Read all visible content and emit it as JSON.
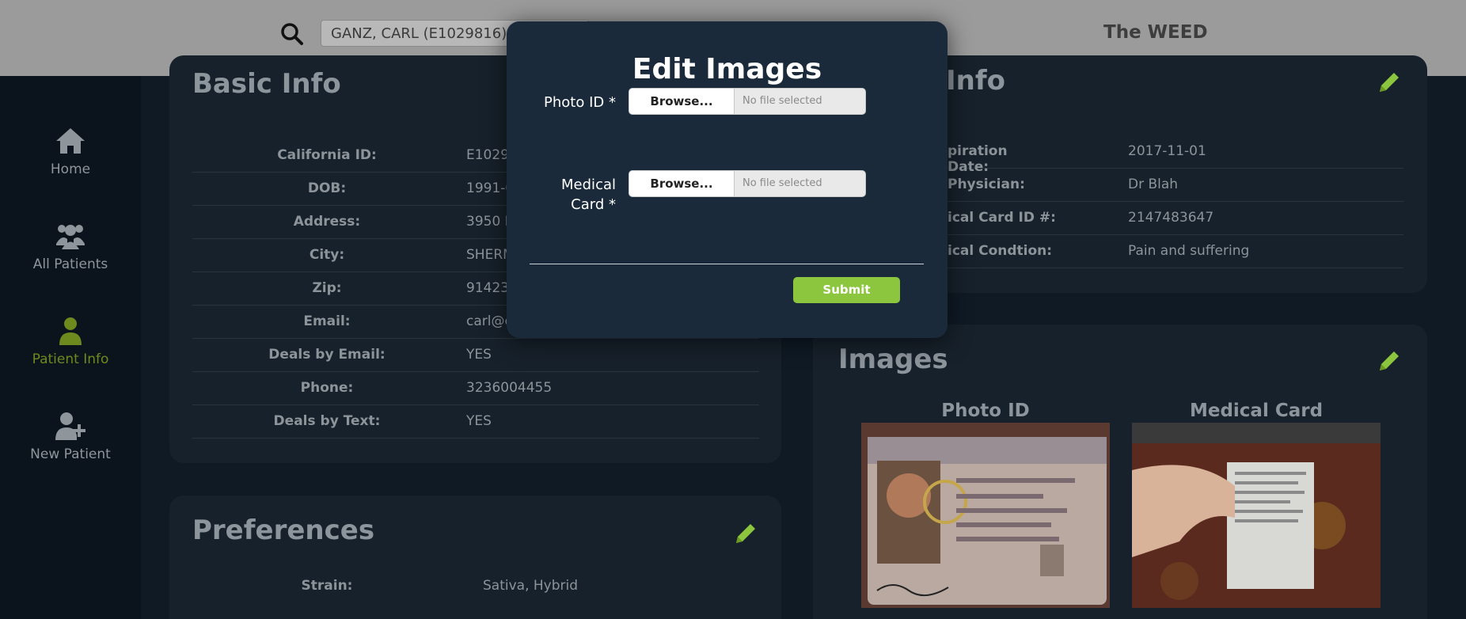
{
  "topbar": {
    "search_value": "GANZ, CARL (E1029816)",
    "brand": "The WEED"
  },
  "sidebar": {
    "items": [
      {
        "label": "Home",
        "icon": "home-icon"
      },
      {
        "label": "All Patients",
        "icon": "users-icon"
      },
      {
        "label": "Patient Info",
        "icon": "user-icon"
      },
      {
        "label": "New Patient",
        "icon": "user-plus-icon"
      }
    ]
  },
  "basic_info": {
    "title": "Basic Info",
    "rows": [
      {
        "label": "California ID:",
        "value": "E10298"
      },
      {
        "label": "DOB:",
        "value": "1991-0"
      },
      {
        "label": "Address:",
        "value": "3950 L"
      },
      {
        "label": "City:",
        "value": "SHERM"
      },
      {
        "label": "Zip:",
        "value": "91423"
      },
      {
        "label": "Email:",
        "value": "carl@c"
      },
      {
        "label": "Deals by Email:",
        "value": "YES"
      },
      {
        "label": "Phone:",
        "value": "3236004455"
      },
      {
        "label": "Deals by Text:",
        "value": "YES"
      }
    ]
  },
  "medical_info": {
    "title": "Info",
    "rows": [
      {
        "label": "piration Date:",
        "value": "2017-11-01"
      },
      {
        "label": "Physician:",
        "value": "Dr Blah"
      },
      {
        "label": "ical Card ID #:",
        "value": "2147483647"
      },
      {
        "label": "ical Condtion:",
        "value": "Pain and suffering"
      }
    ]
  },
  "preferences": {
    "title": "Preferences",
    "rows": [
      {
        "label": "Strain:",
        "value": "Sativa, Hybrid"
      }
    ]
  },
  "images": {
    "title": "Images",
    "photo_id_label": "Photo ID",
    "medical_card_label": "Medical Card"
  },
  "modal": {
    "title": "Edit Images",
    "photo_id_label": "Photo ID *",
    "medical_card_label_line1": "Medical",
    "medical_card_label_line2": "Card *",
    "browse_label": "Browse...",
    "no_file": "No file selected",
    "submit_label": "Submit"
  },
  "colors": {
    "accent": "#8cc63f",
    "modal_bg": "#1b2a3b",
    "topbar_bg": "#9b9b9b"
  }
}
